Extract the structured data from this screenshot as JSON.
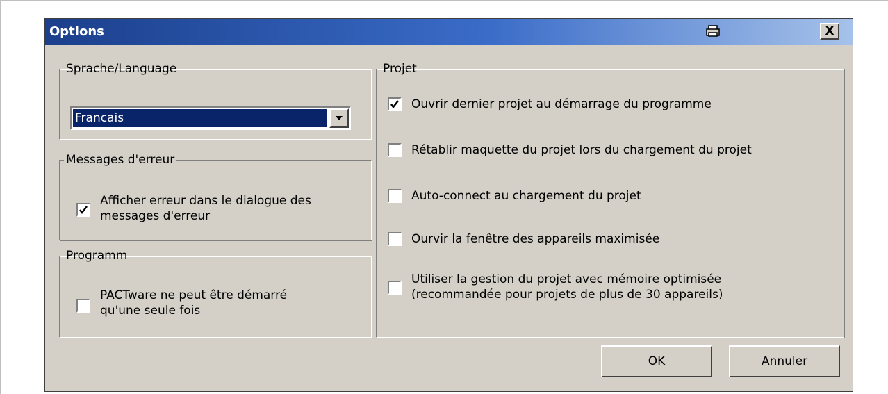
{
  "window": {
    "title": "Options",
    "print_icon": "printer-icon",
    "close_label": "X"
  },
  "language_group": {
    "legend": "Sprache/Language",
    "selected": "Francais"
  },
  "error_group": {
    "legend": "Messages d'erreur",
    "option_line1": "Afficher erreur dans le dialogue des",
    "option_line2": "messages d'erreur",
    "checked": true
  },
  "program_group": {
    "legend": "Programm",
    "option_line1": "PACTware ne peut être démarré",
    "option_line2": "qu'une seule fois",
    "checked": false
  },
  "project_group": {
    "legend": "Projet",
    "options": [
      {
        "line1": "Ouvrir dernier projet au démarrage du programme",
        "line2": "",
        "checked": true
      },
      {
        "line1": "Rétablir maquette du projet lors du chargement du projet",
        "line2": "",
        "checked": false
      },
      {
        "line1": "Auto-connect au chargement du projet",
        "line2": "",
        "checked": false
      },
      {
        "line1": "Ourvir la fenêtre des appareils maximisée",
        "line2": "",
        "checked": false
      },
      {
        "line1": "Utiliser la gestion du projet avec mémoire optimisée",
        "line2": "(recommandée pour projets de plus de 30 appareils)",
        "checked": false
      }
    ]
  },
  "buttons": {
    "ok": "OK",
    "cancel": "Annuler"
  },
  "colors": {
    "title_gradient_start": "#1b3f8c",
    "title_gradient_end": "#a6c2ea",
    "dialog_bg": "#d4d0c8",
    "selection": "#0a246a"
  }
}
